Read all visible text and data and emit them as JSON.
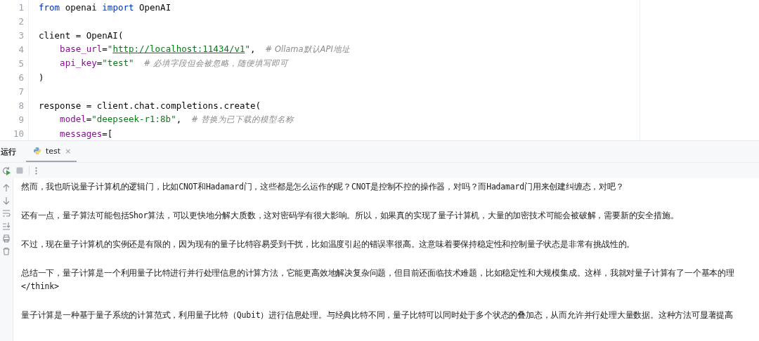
{
  "editor": {
    "lines": [
      {
        "number": "1",
        "tokens": [
          {
            "kind": "keyword",
            "text": "from"
          },
          {
            "kind": "plain",
            "text": " openai "
          },
          {
            "kind": "keyword",
            "text": "import"
          },
          {
            "kind": "plain",
            "text": " OpenAI"
          }
        ]
      },
      {
        "number": "2"
      },
      {
        "number": "3",
        "tokens": [
          {
            "kind": "plain",
            "text": "client = OpenAI("
          }
        ]
      },
      {
        "number": "4",
        "tokens": [
          {
            "kind": "param",
            "text": "    base_url"
          },
          {
            "kind": "plain",
            "text": "="
          },
          {
            "kind": "string",
            "text": "\""
          },
          {
            "kind": "url",
            "text": "http://localhost:11434/v1"
          },
          {
            "kind": "string",
            "text": "\""
          },
          {
            "kind": "plain",
            "text": ","
          },
          {
            "kind": "comment",
            "text": "# Ollama默认API地址"
          }
        ]
      },
      {
        "number": "5",
        "tokens": [
          {
            "kind": "param",
            "text": "    api_key"
          },
          {
            "kind": "plain",
            "text": "="
          },
          {
            "kind": "string",
            "text": "\"test\""
          },
          {
            "kind": "comment",
            "text": "# 必填字段但会被忽略，随便填写即可"
          }
        ]
      },
      {
        "number": "6",
        "tokens": [
          {
            "kind": "plain",
            "text": ")"
          }
        ]
      },
      {
        "number": "7"
      },
      {
        "number": "8",
        "tokens": [
          {
            "kind": "plain",
            "text": "response = client.chat.completions.create("
          }
        ]
      },
      {
        "number": "9",
        "tokens": [
          {
            "kind": "param",
            "text": "    model"
          },
          {
            "kind": "plain",
            "text": "="
          },
          {
            "kind": "string",
            "text": "\"deepseek-r1:8b\""
          },
          {
            "kind": "plain",
            "text": ","
          },
          {
            "kind": "comment",
            "text": "# 替换为已下载的模型名称"
          }
        ]
      },
      {
        "number": "10",
        "tokens": [
          {
            "kind": "param",
            "text": "    messages"
          },
          {
            "kind": "plain",
            "text": "=["
          }
        ]
      }
    ]
  },
  "run_panel": {
    "title": "运行",
    "tabs": [
      {
        "label": "test",
        "selected": true,
        "close": "×"
      }
    ],
    "paragraphs": [
      [
        "然而，我也听说量子计算机的逻辑门，比如CNOT和Hadamard门，这些都是怎么运作的呢？CNOT是控制不控的操作器，对吗？而Hadamard门用来创建纠缠态，对吧？"
      ],
      [
        "还有一点，量子算法可能包括Shor算法，可以更快地分解大质数，这对密码学有很大影响。所以，如果真的实现了量子计算机，大量的加密技术可能会被破解，需要新的安全措施。"
      ],
      [
        "不过，现在量子计算机的实例还是有限的，因为现有的量子比特容易受到干扰，比如温度引起的错误率很高。这意味着要保持稳定性和控制量子状态是非常有挑战性的。"
      ],
      [
        "总结一下，量子计算是一个利用量子比特进行并行处理信息的计算方法，它能更高效地解决复杂问题，但目前还面临技术难题，比如稳定性和大规模集成。这样，我就对量子计算有了一个基本的理",
        "</think>"
      ],
      [
        "量子计算是一种基于量子系统的计算范式，利用量子比特（Qubit）进行信息处理。与经典比特不同，量子比特可以同时处于多个状态的叠加态，从而允许并行处理大量数据。这种方法可显著提高"
      ]
    ]
  }
}
